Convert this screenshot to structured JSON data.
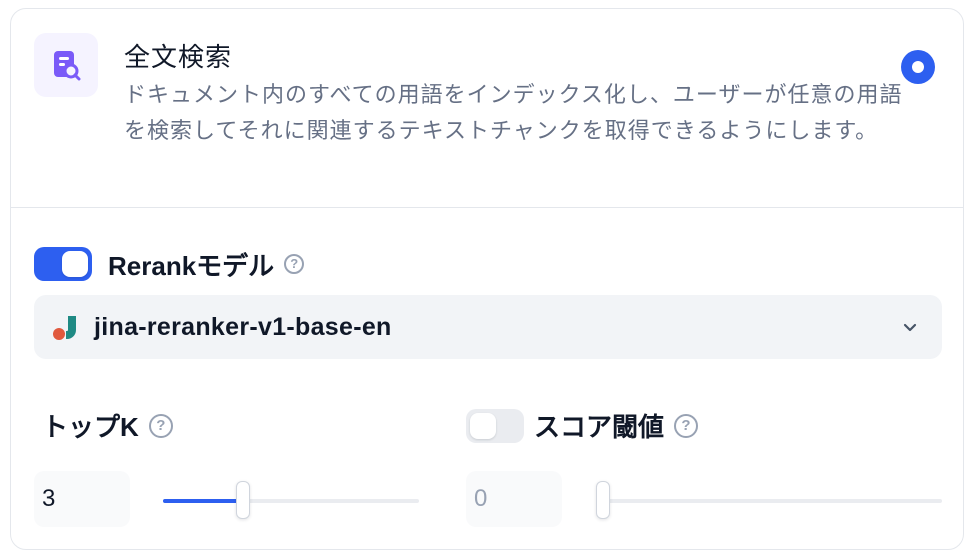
{
  "search_method": {
    "title": "全文検索",
    "description": "ドキュメント内のすべての用語をインデックス化し、ユーザーが任意の用語を検索してそれに関連するテキストチャンクを取得できるようにします。",
    "selected": true,
    "icon": "document-search-icon"
  },
  "rerank": {
    "enabled": true,
    "label": "Rerankモデル",
    "help_icon": "question-circle-icon",
    "model": {
      "name": "jina-reranker-v1-base-en",
      "icon": "jina-logo-icon"
    }
  },
  "top_k": {
    "label": "トップK",
    "value": "3",
    "slider_fraction": 0.3
  },
  "score_threshold": {
    "enabled": false,
    "label": "スコア閾値",
    "value": "0",
    "slider_fraction": 0
  },
  "colors": {
    "accent": "#2d5ff0",
    "icon_purple": "#7a5af8",
    "jina_red": "#e0593e",
    "jina_teal": "#1f8a84"
  }
}
